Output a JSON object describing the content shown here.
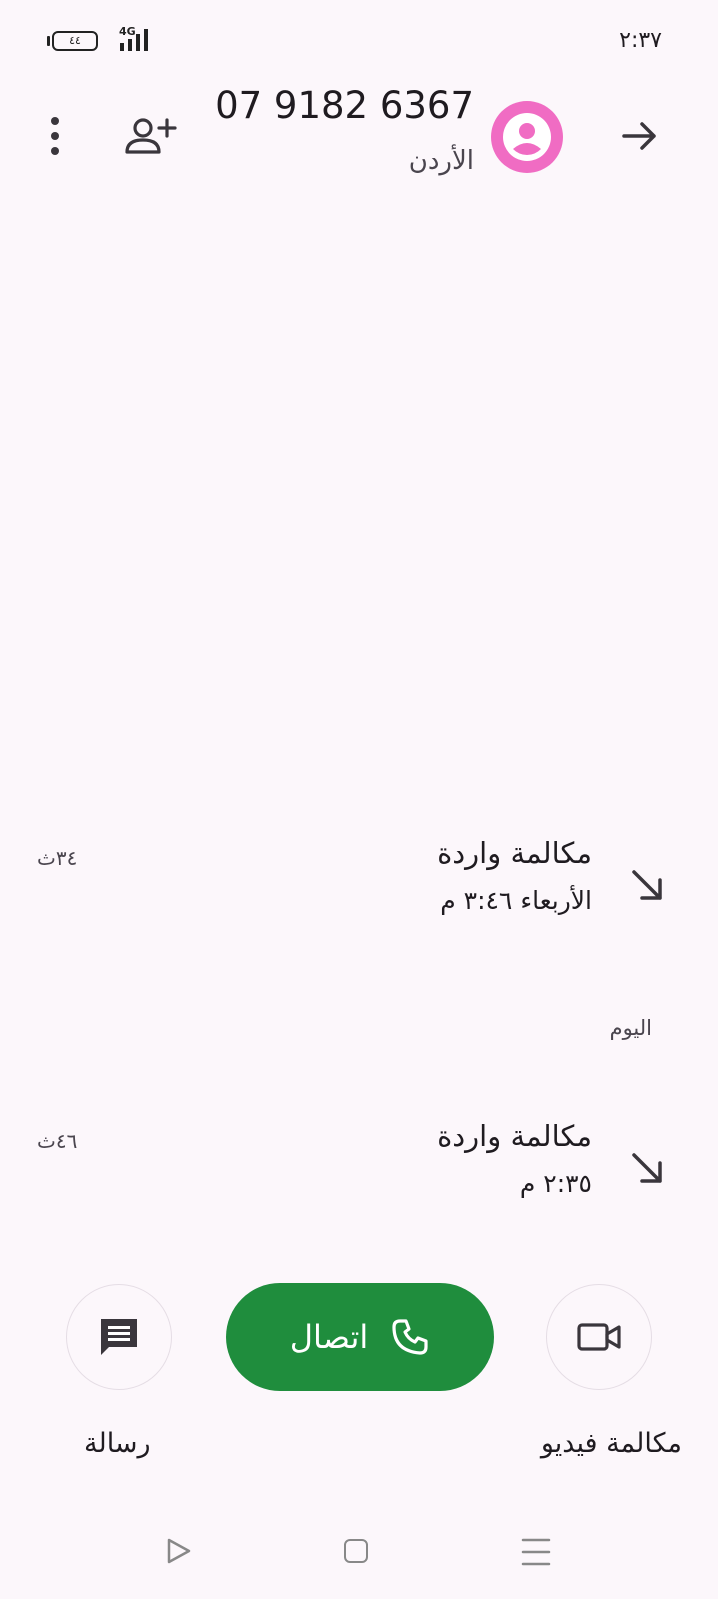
{
  "status_bar": {
    "time": "٢:٣٧",
    "network": "4G",
    "battery": "٤٤"
  },
  "header": {
    "phone_number": "07 9182 6367",
    "country": "الأردن"
  },
  "icons": {
    "back": "arrow-right-icon",
    "avatar": "person-icon",
    "add_contact": "person-add-icon",
    "more": "more-vert-icon",
    "incoming_call": "call-received-icon",
    "phone": "phone-icon",
    "video": "videocam-icon",
    "message": "message-icon"
  },
  "colors": {
    "avatar": "#f06cc3",
    "call_button": "#1f8d3d",
    "background": "#fcf7fb"
  },
  "call_log": {
    "entries": [
      {
        "type": "مكالمة واردة",
        "time": "الأربعاء ٣:٤٦ م",
        "duration": "٣٤ث"
      },
      {
        "type": "مكالمة واردة",
        "time": "٢:٣٥ م",
        "duration": "٤٦ث"
      }
    ],
    "section_today": "اليوم"
  },
  "actions": {
    "video_label": "مكالمة فيديو",
    "call_label": "اتصال",
    "message_label": "رسالة"
  }
}
